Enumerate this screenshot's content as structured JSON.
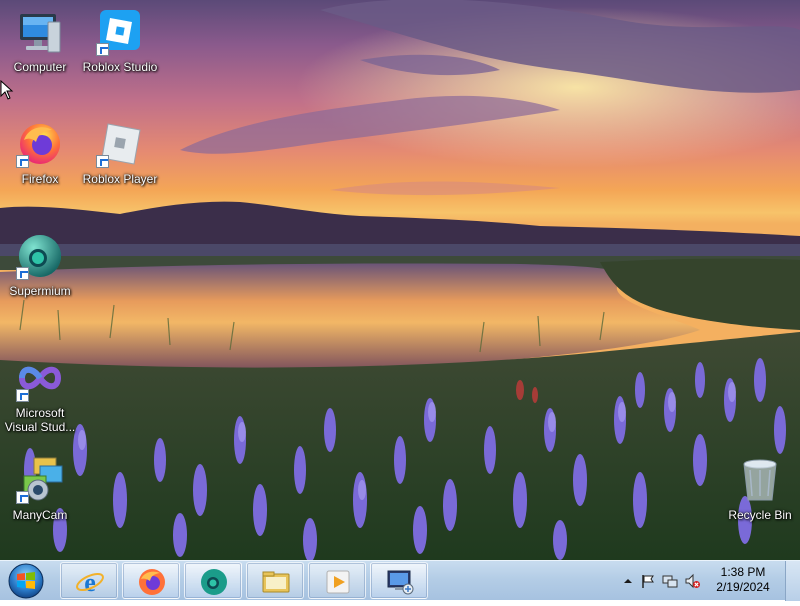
{
  "desktop": {
    "icons": [
      {
        "label": "Computer",
        "icon": "computer-icon"
      },
      {
        "label": "Roblox Studio",
        "icon": "roblox-studio-icon"
      },
      {
        "label": "Firefox",
        "icon": "firefox-icon"
      },
      {
        "label": "Roblox Player",
        "icon": "roblox-player-icon"
      },
      {
        "label": "Supermium",
        "icon": "supermium-icon"
      },
      {
        "label": "Microsoft Visual Stud...",
        "icon": "visual-studio-icon"
      },
      {
        "label": "ManyCam",
        "icon": "manycam-icon"
      },
      {
        "label": "Recycle Bin",
        "icon": "recycle-bin-icon"
      }
    ]
  },
  "taskbar": {
    "start": {
      "icon": "windows-start-orb-icon"
    },
    "pinned": [
      {
        "name": "Internet Explorer",
        "icon": "internet-explorer-icon"
      },
      {
        "name": "Firefox",
        "icon": "firefox-icon"
      },
      {
        "name": "Supermium",
        "icon": "supermium-icon"
      },
      {
        "name": "Windows Explorer",
        "icon": "folder-icon"
      },
      {
        "name": "Windows Media Player",
        "icon": "media-player-icon"
      },
      {
        "name": "Remote Desktop",
        "icon": "remote-desktop-icon"
      }
    ],
    "tray": {
      "icons": [
        "show-hidden-icons-icon",
        "action-center-flag-icon",
        "network-icon",
        "volume-muted-icon"
      ],
      "time": "1:38 PM",
      "date": "2/19/2024"
    }
  },
  "colors": {
    "taskbar": "#b4cde6",
    "sky_top": "#5b4a78",
    "sunset": "#f4a656",
    "flowers": "#7a6ad8"
  }
}
